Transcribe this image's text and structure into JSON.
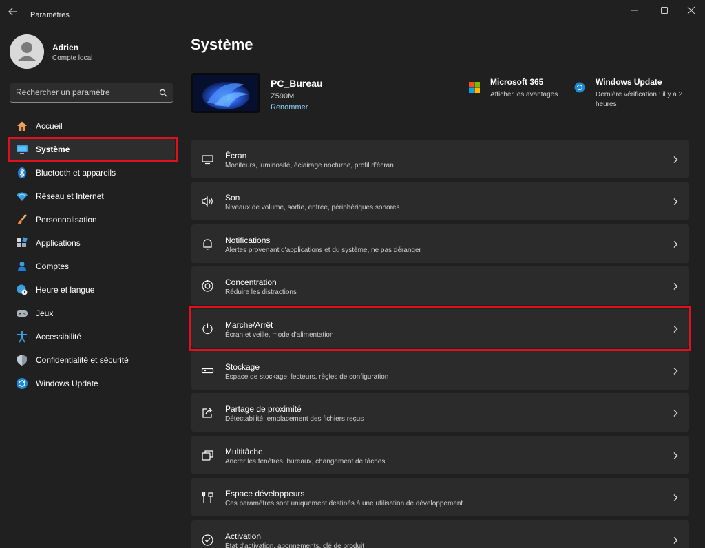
{
  "window": {
    "title": "Paramètres",
    "back_icon": "arrow-left-icon",
    "controls": [
      "minimize-icon",
      "maximize-icon",
      "close-icon"
    ]
  },
  "profile": {
    "name": "Adrien",
    "account_type": "Compte local",
    "avatar_icon": "user-avatar-icon"
  },
  "search": {
    "placeholder": "Rechercher un paramètre",
    "value": "",
    "icon": "search-icon"
  },
  "sidebar": {
    "active_item": "Système",
    "items": [
      {
        "label": "Accueil",
        "icon": "home-icon"
      },
      {
        "label": "Système",
        "icon": "monitor-icon"
      },
      {
        "label": "Bluetooth et appareils",
        "icon": "bluetooth-icon"
      },
      {
        "label": "Réseau et Internet",
        "icon": "wifi-icon"
      },
      {
        "label": "Personnalisation",
        "icon": "paintbrush-icon"
      },
      {
        "label": "Applications",
        "icon": "apps-icon"
      },
      {
        "label": "Comptes",
        "icon": "account-icon"
      },
      {
        "label": "Heure et langue",
        "icon": "globe-clock-icon"
      },
      {
        "label": "Jeux",
        "icon": "gamepad-icon"
      },
      {
        "label": "Accessibilité",
        "icon": "accessibility-icon"
      },
      {
        "label": "Confidentialité et sécurité",
        "icon": "shield-icon"
      },
      {
        "label": "Windows Update",
        "icon": "windows-update-icon"
      }
    ]
  },
  "main": {
    "title": "Système",
    "device": {
      "name": "PC_Bureau",
      "model": "Z590M",
      "rename_label": "Renommer"
    },
    "promos": [
      {
        "title": "Microsoft 365",
        "subtitle": "Afficher les avantages",
        "icon": "microsoft-logo-icon"
      },
      {
        "title": "Windows Update",
        "subtitle": "Dernière vérification : il y a 2 heures",
        "icon": "windows-update-icon"
      }
    ],
    "cards": [
      {
        "title": "Écran",
        "subtitle": "Moniteurs, luminosité, éclairage nocturne, profil d'écran",
        "icon": "display-icon"
      },
      {
        "title": "Son",
        "subtitle": "Niveaux de volume, sortie, entrée, périphériques sonores",
        "icon": "speaker-icon"
      },
      {
        "title": "Notifications",
        "subtitle": "Alertes provenant d'applications et du système, ne pas déranger",
        "icon": "bell-icon"
      },
      {
        "title": "Concentration",
        "subtitle": "Réduire les distractions",
        "icon": "focus-icon"
      },
      {
        "title": "Marche/Arrêt",
        "subtitle": "Écran et veille, mode d'alimentation",
        "icon": "power-icon"
      },
      {
        "title": "Stockage",
        "subtitle": "Espace de stockage, lecteurs, règles de configuration",
        "icon": "storage-icon"
      },
      {
        "title": "Partage de proximité",
        "subtitle": "Détectabilité, emplacement des fichiers reçus",
        "icon": "share-icon"
      },
      {
        "title": "Multitâche",
        "subtitle": "Ancrer les fenêtres, bureaux, changement de tâches",
        "icon": "multitask-icon"
      },
      {
        "title": "Espace développeurs",
        "subtitle": "Ces paramètres sont uniquement destinés à une utilisation de développement",
        "icon": "developer-tools-icon"
      },
      {
        "title": "Activation",
        "subtitle": "État d'activation, abonnements, clé de produit",
        "icon": "activation-icon"
      }
    ]
  },
  "colors": {
    "background": "#202020",
    "card": "#2b2b2b",
    "accent": "#8ad3f7",
    "highlight_border": "#e0101f"
  }
}
